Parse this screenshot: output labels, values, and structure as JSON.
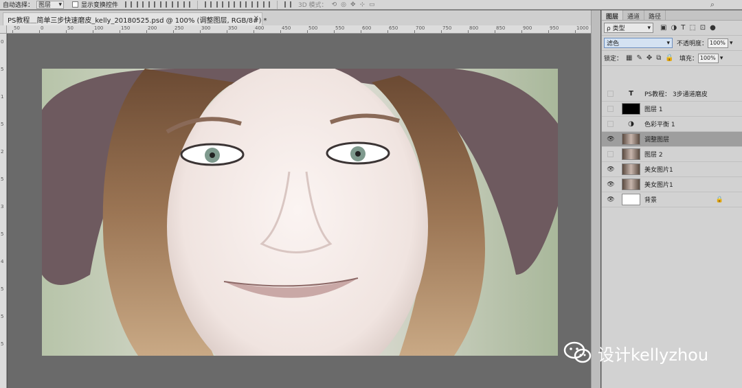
{
  "optbar": {
    "auto_select_label": "自动选择：",
    "auto_select_value": "图层",
    "show_transform_label": "显示变换控件",
    "mode_3d_label": "3D 模式：",
    "icon_3d": "3d-mode-icons",
    "search_icon": "search-icon"
  },
  "document": {
    "tab_title": "PS教程＿简单三步快速磨皮_kelly_20180525.psd @ 100% (调整图层, RGB/8#) *",
    "close_glyph": "×"
  },
  "ruler": {
    "h_ticks": [
      "50",
      "0",
      "50",
      "100",
      "150",
      "200",
      "250",
      "300",
      "350",
      "400",
      "450",
      "500",
      "550",
      "600",
      "650",
      "700",
      "750",
      "800",
      "850",
      "900",
      "950",
      "1000"
    ],
    "v_ticks": [
      "0",
      "5",
      "1",
      "5",
      "2",
      "5",
      "3",
      "5",
      "4",
      "5",
      "5",
      "5"
    ]
  },
  "panel": {
    "tabs": [
      "图层",
      "通道",
      "路径"
    ],
    "filter_label": "ρ 类型",
    "blend_mode": "滤色",
    "opacity_label": "不透明度：",
    "opacity_value": "100%",
    "lock_label": "锁定：",
    "fill_label": "填充：",
    "fill_value": "100%",
    "layers": [
      {
        "name": "PS教程： 3步通道磨皮",
        "type": "text",
        "visible": false,
        "selected": false
      },
      {
        "name": "图层 1",
        "type": "black",
        "visible": false,
        "selected": false
      },
      {
        "name": "色彩平衡 1",
        "type": "adjust",
        "visible": false,
        "selected": false
      },
      {
        "name": "调整图层",
        "type": "photo",
        "visible": true,
        "selected": true
      },
      {
        "name": "图层 2",
        "type": "photo",
        "visible": false,
        "selected": false
      },
      {
        "name": "美女图片1",
        "type": "photo",
        "visible": true,
        "selected": false
      },
      {
        "name": "美女图片1",
        "type": "photo",
        "visible": true,
        "selected": false
      },
      {
        "name": "背景",
        "type": "white",
        "visible": true,
        "selected": false,
        "locked": true
      }
    ]
  },
  "watermark": {
    "text": "设计kellyzhou",
    "icon": "wechat-icon"
  },
  "colors": {
    "selected_layer": "#9e9e9e",
    "workspace": "#6a6a6a",
    "blend_dropdown": "#d4e2f2"
  }
}
